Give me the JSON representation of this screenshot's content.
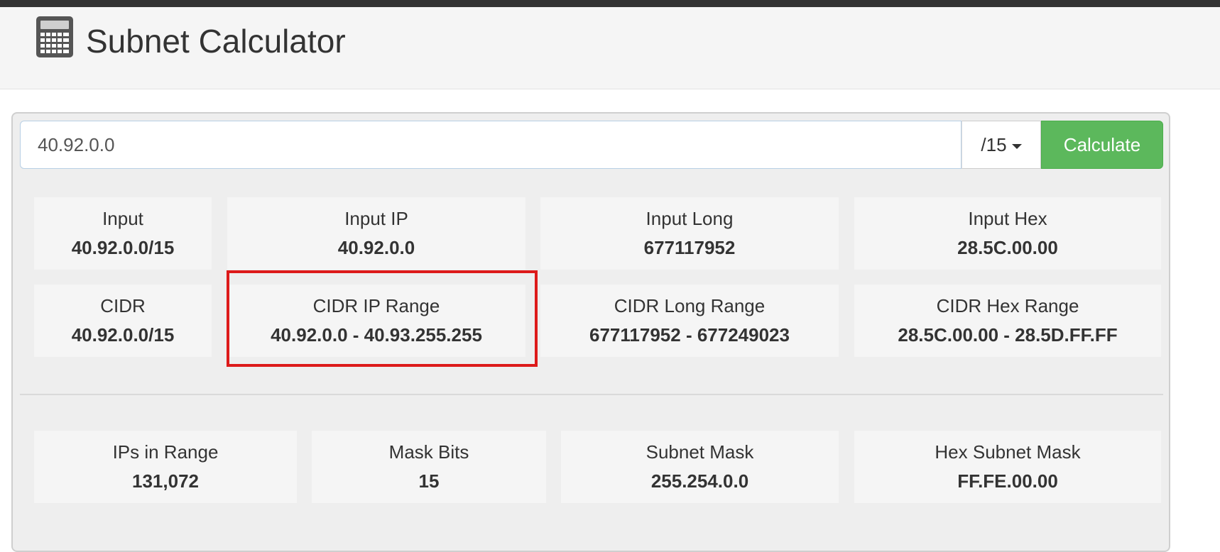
{
  "header": {
    "title": "Subnet Calculator",
    "icon": "calculator-icon"
  },
  "form": {
    "ip_value": "40.92.0.0",
    "mask_selected": "/15",
    "calculate_label": "Calculate"
  },
  "results": {
    "input": {
      "label": "Input",
      "value": "40.92.0.0/15"
    },
    "input_ip": {
      "label": "Input IP",
      "value": "40.92.0.0"
    },
    "input_long": {
      "label": "Input Long",
      "value": "677117952"
    },
    "input_hex": {
      "label": "Input Hex",
      "value": "28.5C.00.00"
    },
    "cidr": {
      "label": "CIDR",
      "value": "40.92.0.0/15"
    },
    "cidr_ip_range": {
      "label": "CIDR IP Range",
      "value": "40.92.0.0 - 40.93.255.255"
    },
    "cidr_long_range": {
      "label": "CIDR Long Range",
      "value": "677117952 - 677249023"
    },
    "cidr_hex_range": {
      "label": "CIDR Hex Range",
      "value": "28.5C.00.00 - 28.5D.FF.FF"
    },
    "ips_in_range": {
      "label": "IPs in Range",
      "value": "131,072"
    },
    "mask_bits": {
      "label": "Mask Bits",
      "value": "15"
    },
    "subnet_mask": {
      "label": "Subnet Mask",
      "value": "255.254.0.0"
    },
    "hex_subnet_mask": {
      "label": "Hex Subnet Mask",
      "value": "FF.FE.00.00"
    }
  },
  "colors": {
    "accent_green": "#5cb85c",
    "highlight_red": "#dd1a1a",
    "topbar": "#333333"
  }
}
